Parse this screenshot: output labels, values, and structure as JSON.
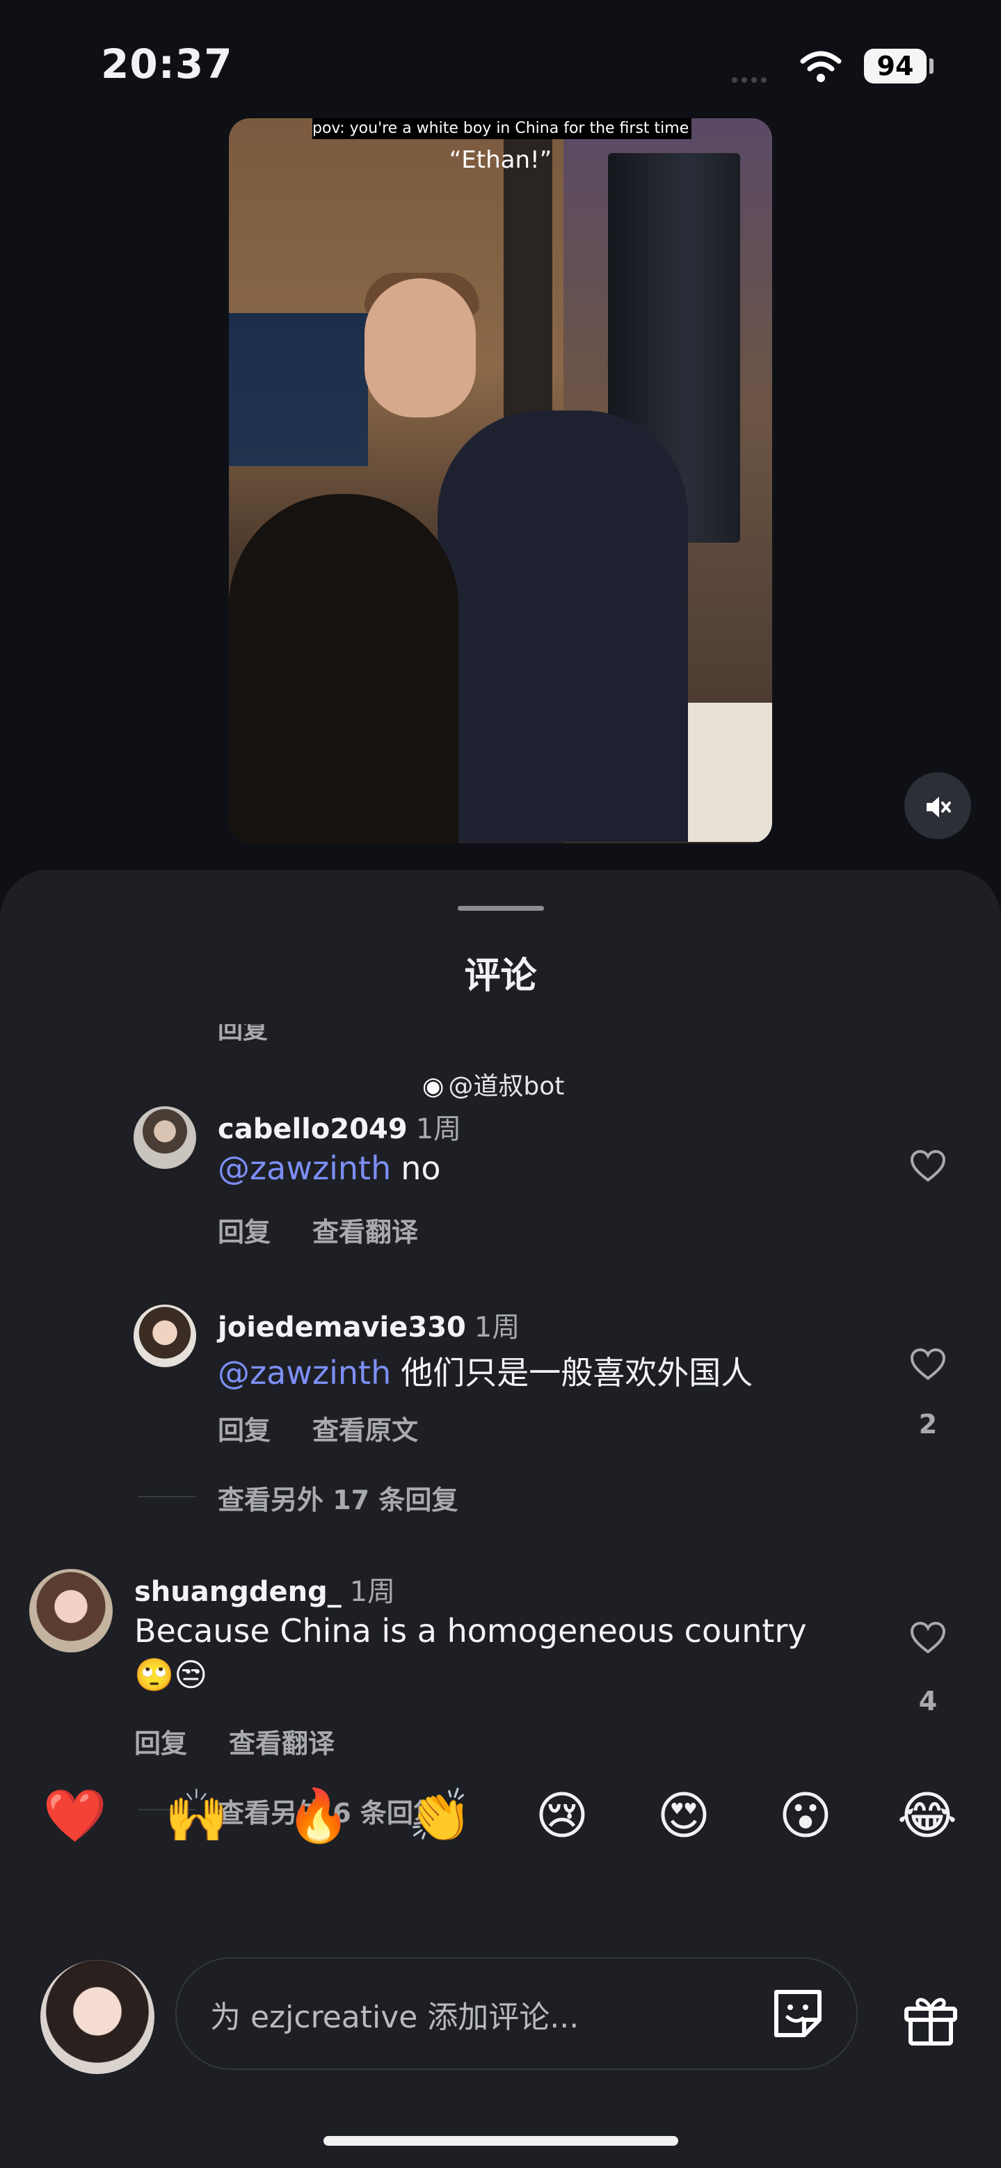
{
  "status_bar": {
    "time": "20:37",
    "battery": "94"
  },
  "video": {
    "caption": "pov: you're a white boy in China for the first time 🇨🇳",
    "quote": "“Ethan!”"
  },
  "sheet": {
    "title": "评论",
    "partial_reply_label": "回复",
    "watermark": "@道叔bot",
    "comments": [
      {
        "username": "cabello2049",
        "time": "1周",
        "mention": "@zawzinth",
        "text": "no",
        "reply_label": "回复",
        "translate_label": "查看翻译",
        "likes": ""
      },
      {
        "username": "joiedemavie330",
        "time": "1周",
        "mention": "@zawzinth",
        "text": "他们只是一般喜欢外国人",
        "reply_label": "回复",
        "translate_label": "查看原文",
        "likes": "2",
        "more_replies": "查看另外 17 条回复"
      },
      {
        "username": "shuangdeng_",
        "time": "1周",
        "text": "Because China is a homogeneous country",
        "text_line2": "🙄😒",
        "reply_label": "回复",
        "translate_label": "查看翻译",
        "likes": "4",
        "more_replies": "查看另外 6 条回复"
      }
    ]
  },
  "emoji_bar": [
    "❤️",
    "🙌",
    "🔥",
    "👏",
    "😢",
    "😍",
    "😮",
    "😂"
  ],
  "input": {
    "placeholder": "为 ezjcreative 添加评论..."
  },
  "icons": [
    "mute-icon",
    "heart-icon",
    "sticker-icon",
    "gift-icon",
    "wifi-icon",
    "weibo-icon"
  ]
}
